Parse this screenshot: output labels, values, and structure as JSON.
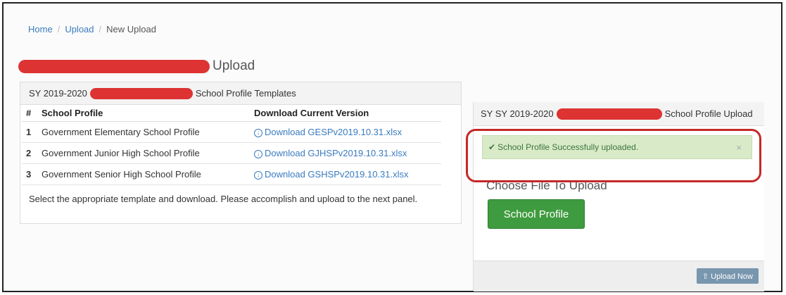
{
  "breadcrumb": {
    "home": "Home",
    "upload": "Upload",
    "current": "New Upload"
  },
  "page_title": "Upload",
  "templates_panel": {
    "title_prefix": "SY 2019-2020",
    "title_suffix": "School Profile Templates",
    "columns": {
      "num": "#",
      "profile": "School Profile",
      "download": "Download Current Version"
    },
    "rows": [
      {
        "num": "1",
        "profile": "Government Elementary School Profile",
        "download": "Download GESPv2019.10.31.xlsx"
      },
      {
        "num": "2",
        "profile": "Government Junior High School Profile",
        "download": "Download GJHSPv2019.10.31.xlsx"
      },
      {
        "num": "3",
        "profile": "Government Senior High School Profile",
        "download": "Download GSHSPv2019.10.31.xlsx"
      }
    ],
    "note": "Select the appropriate template and download. Please accomplish and upload to the next panel."
  },
  "upload_panel": {
    "title_prefix": "SY SY 2019-2020",
    "title_suffix": "School Profile Upload",
    "alert": "School Profile Successfully uploaded.",
    "choose_label": "Choose File To Upload",
    "profile_button": "School Profile",
    "upload_button": "Upload Now"
  },
  "colors": {
    "link": "#3a7bbf",
    "success_bg": "#d9eac9",
    "button_green": "#3f9b3f",
    "redaction": "#dd3333",
    "highlight": "#c62828"
  }
}
